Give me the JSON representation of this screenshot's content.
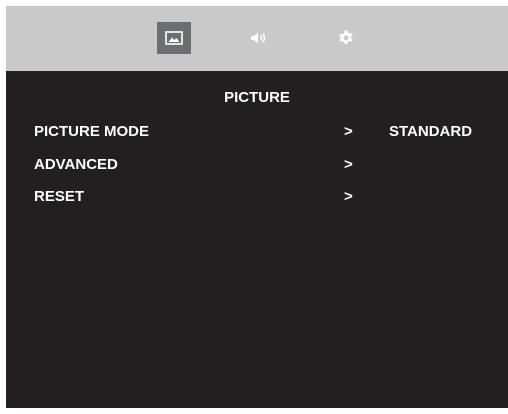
{
  "tabs": [
    {
      "name": "picture",
      "icon": "picture-icon",
      "active": true
    },
    {
      "name": "sound",
      "icon": "speaker-icon",
      "active": false
    },
    {
      "name": "setup",
      "icon": "gear-icon",
      "active": false
    }
  ],
  "menu": {
    "title": "PICTURE",
    "items": [
      {
        "label": "PICTURE MODE",
        "arrow": ">",
        "value": "STANDARD"
      },
      {
        "label": "ADVANCED",
        "arrow": ">",
        "value": ""
      },
      {
        "label": "RESET",
        "arrow": ">",
        "value": ""
      }
    ]
  },
  "colors": {
    "background": "#231f20",
    "tab_bar": "#c9c9c9",
    "active_tab": "#6d6e71",
    "text": "#ffffff"
  }
}
